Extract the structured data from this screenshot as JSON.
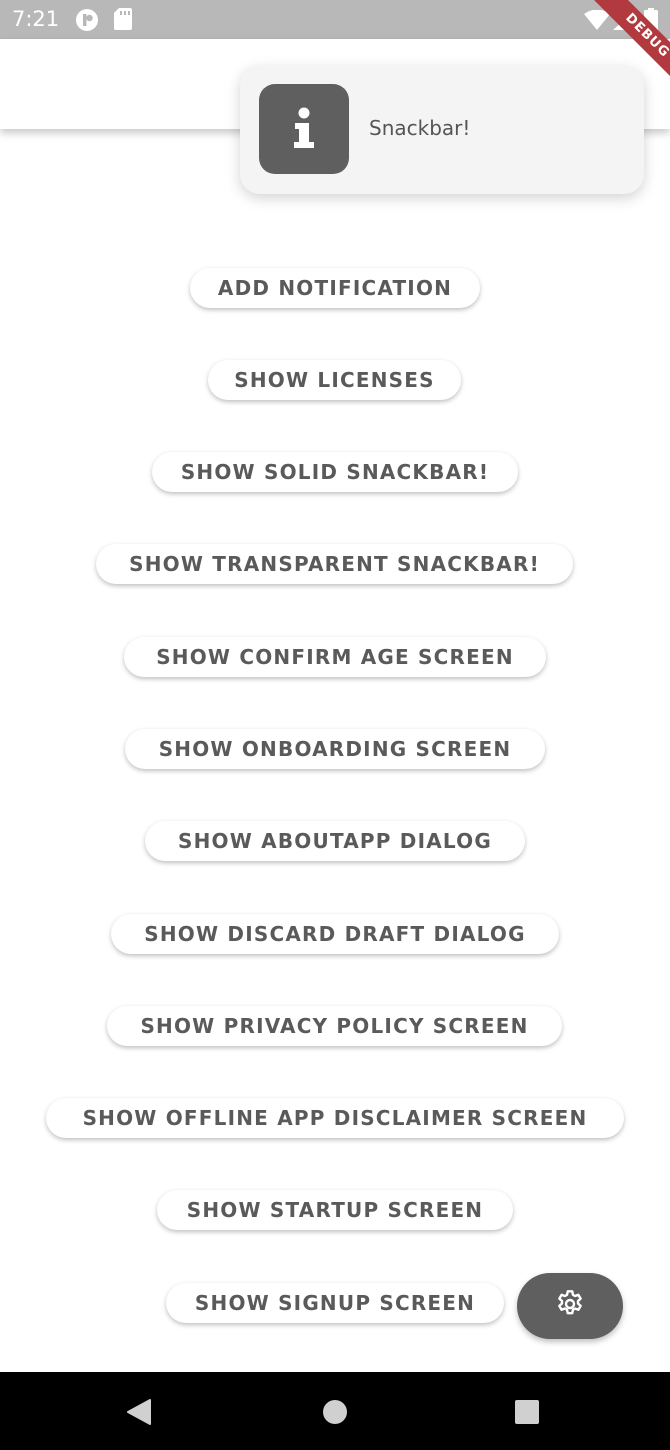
{
  "status_bar": {
    "time": "7:21",
    "icons": [
      "app-notification-icon",
      "sd-card-icon",
      "wifi-icon",
      "signal-icon",
      "battery-icon"
    ]
  },
  "debug_banner": {
    "label": "DEBUG"
  },
  "snackbar": {
    "icon": "info-icon",
    "message": "Snackbar!"
  },
  "buttons": [
    "ADD NOTIFICATION",
    "SHOW LICENSES",
    "SHOW SOLID SNACKBAR!",
    "SHOW TRANSPARENT SNACKBAR!",
    "SHOW CONFIRM AGE SCREEN",
    "SHOW ONBOARDING SCREEN",
    "SHOW ABOUTAPP DIALOG",
    "SHOW DISCARD DRAFT DIALOG",
    "SHOW PRIVACY POLICY SCREEN",
    "SHOW OFFLINE APP DISCLAIMER SCREEN",
    "SHOW STARTUP SCREEN",
    "SHOW SIGNUP SCREEN"
  ],
  "fab": {
    "icon": "gear-icon"
  },
  "navigation": {
    "icons": [
      "back-icon",
      "home-icon",
      "recent-apps-icon"
    ]
  },
  "colors": {
    "status_bar": "#b8b8b8",
    "accent_dark": "#5f5f5f",
    "button_text": "#5a5a5a",
    "debug_ribbon": "#b23a3e"
  }
}
